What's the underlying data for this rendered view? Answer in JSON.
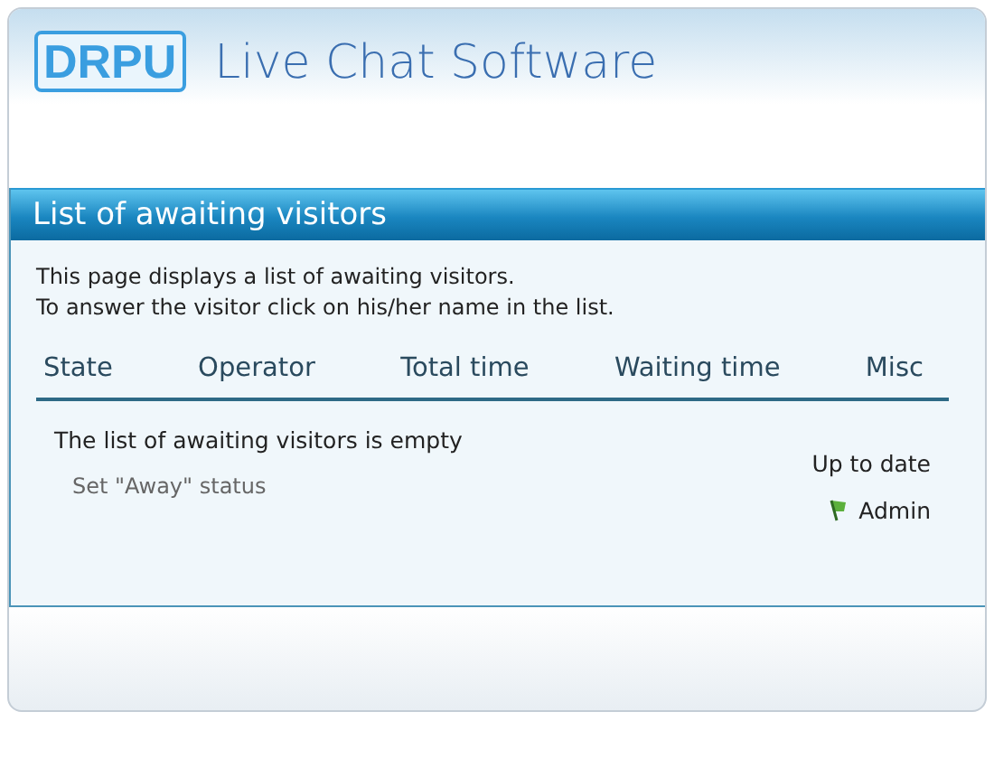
{
  "header": {
    "logo": "DRPU",
    "title": "Live Chat Software"
  },
  "panel": {
    "title": "List of awaiting visitors",
    "intro": [
      "This page displays a list of awaiting visitors.",
      "To answer the visitor click on his/her name in the list."
    ],
    "columns": [
      "State",
      "Operator",
      "Total time",
      "Waiting time",
      "Misc"
    ],
    "empty_message": "The list of awaiting visitors is empty",
    "away_link": "Set \"Away\" status",
    "update_status": "Up to date",
    "operator": "Admin"
  }
}
